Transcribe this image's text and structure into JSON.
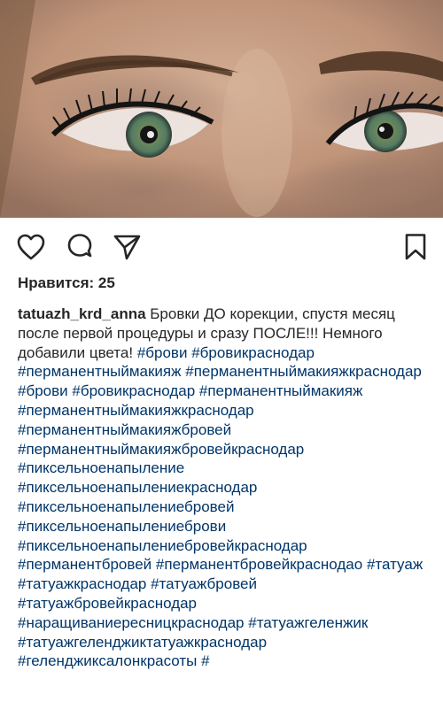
{
  "post": {
    "likes_label": "Нравится: 25",
    "username": "tatuazh_krd_anna",
    "caption_text": " Бровки ДО корекции, спустя месяц после первой процедуры и сразу ПОСЛЕ!!! Немного добавили цвета! ",
    "hashtags": [
      "#брови",
      "#бровикраснодар",
      "#перманентныймакияж",
      "#перманентныймакияжкраснодар",
      "#брови",
      "#бровикраснодар",
      "#перманентныймакияж",
      "#перманентныймакияжкраснодар",
      "#перманентныймакияжбровей",
      "#перманентныймакияжбровейкраснодар",
      "#пиксельноенапыление",
      "#пиксельноенапылениекраснодар",
      "#пиксельноенапылениебровей",
      "#пиксельноенапылениеброви",
      "#пиксельноенапылениебровейкраснодар",
      "#перманентбровей",
      "#перманентбровейкраснодао",
      "#татуаж",
      "#татуажкраснодар",
      "#татуажбровей",
      "#татуажбровейкраснодар",
      "#наращиваниересницкраснодар",
      "#татуажгеленжик",
      "#татуажгеленджиктатуажкраснодар",
      "#геленджиксалонкрасоты",
      "#"
    ]
  },
  "icons": {
    "like": "heart-outline-icon",
    "comment": "comment-bubble-icon",
    "share": "paper-plane-icon",
    "save": "bookmark-icon"
  },
  "colors": {
    "text": "#262626",
    "hashtag": "#003569",
    "icon": "#262626"
  }
}
